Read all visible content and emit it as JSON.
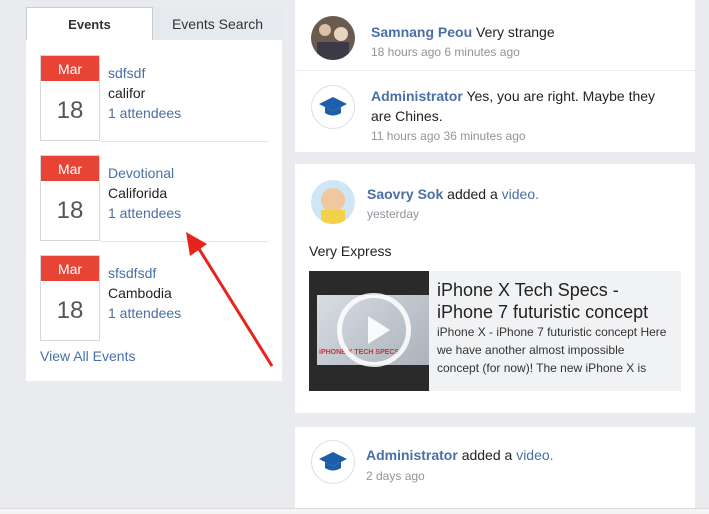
{
  "events_panel": {
    "tabs": [
      {
        "label": "Events",
        "active": true
      },
      {
        "label": "Events Search",
        "active": false
      }
    ],
    "events": [
      {
        "month": "Mar",
        "day": "18",
        "title": "sdfsdf",
        "location": "califor",
        "attendees": "1 attendees"
      },
      {
        "month": "Mar",
        "day": "18",
        "title": "Devotional",
        "location": "Califorida",
        "attendees": "1 attendees"
      },
      {
        "month": "Mar",
        "day": "18",
        "title": "sfsdfsdf",
        "location": "Cambodia",
        "attendees": "1 attendees"
      }
    ],
    "view_all": "View All Events"
  },
  "feed": {
    "comments": [
      {
        "name": "Samnang Peou",
        "text": "Very strange",
        "time": "18 hours ago",
        "time2": "6 minutes ago"
      },
      {
        "name": "Administrator",
        "text": "Yes, you are right. Maybe they",
        "text2": "are Chines.",
        "time": "11 hours ago",
        "time2": "36 minutes ago"
      }
    ],
    "post_video": {
      "name": "Saovry Sok",
      "action": "added a",
      "link": "video.",
      "time": "yesterday",
      "body": "Very Express",
      "video_title_1": "iPhone X Tech Specs -",
      "video_title_2": "iPhone 7 futuristic concept",
      "video_desc_1": "iPhone X - iPhone 7 futuristic concept Here",
      "video_desc_2": "we have another almost impossible",
      "video_desc_3": "concept (for now)! The new iPhone X is",
      "thumb_brand": "iPHONE X TECH SPECS"
    },
    "post_admin": {
      "name": "Administrator",
      "action": "added a",
      "link": "video.",
      "time": "2 days ago"
    }
  },
  "colors": {
    "accent_red": "#e84436",
    "link_blue": "#4a6fa5",
    "annotation_arrow": "#e8221c"
  },
  "icons": {
    "admin_avatar": "graduation-cap-icon",
    "video_play": "play-icon"
  }
}
